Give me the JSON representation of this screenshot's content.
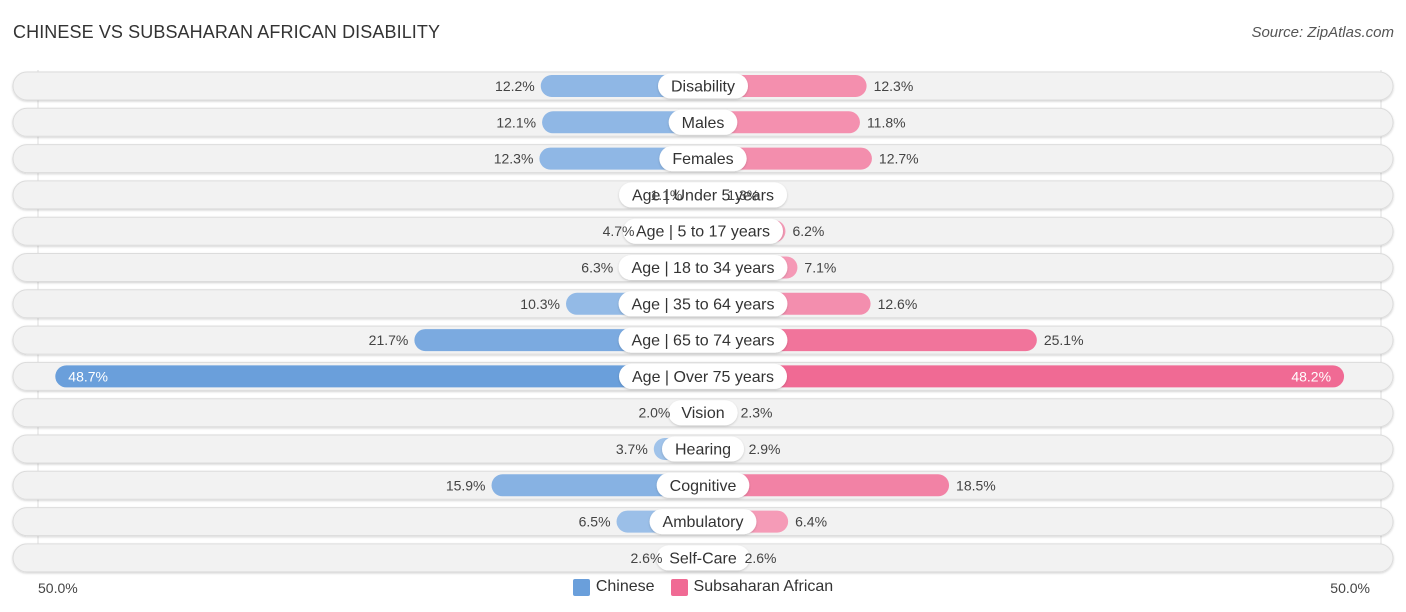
{
  "header": {
    "title": "CHINESE VS SUBSAHARAN AFRICAN DISABILITY",
    "source": "Source: ZipAtlas.com"
  },
  "colors": {
    "chinese": "#6a9fdb",
    "chinese_light": "#a8c8ec",
    "subsaharan": "#f06a94",
    "subsaharan_light": "#f6a8c0",
    "track": "#f2f2f2"
  },
  "chart_data": {
    "type": "bar",
    "orientation": "horizontal-diverging",
    "title": "CHINESE VS SUBSAHARAN AFRICAN DISABILITY",
    "categories": [
      "Disability",
      "Males",
      "Females",
      "Age | Under 5 years",
      "Age | 5 to 17 years",
      "Age | 18 to 34 years",
      "Age | 35 to 64 years",
      "Age | 65 to 74 years",
      "Age | Over 75 years",
      "Vision",
      "Hearing",
      "Cognitive",
      "Ambulatory",
      "Self-Care"
    ],
    "series": [
      {
        "name": "Chinese",
        "side": "left",
        "values": [
          12.2,
          12.1,
          12.3,
          1.1,
          4.7,
          6.3,
          10.3,
          21.7,
          48.7,
          2.0,
          3.7,
          15.9,
          6.5,
          2.6
        ]
      },
      {
        "name": "Subsaharan African",
        "side": "right",
        "values": [
          12.3,
          11.8,
          12.7,
          1.3,
          6.2,
          7.1,
          12.6,
          25.1,
          48.2,
          2.3,
          2.9,
          18.5,
          6.4,
          2.6
        ]
      }
    ],
    "value_suffix": "%",
    "xlim": [
      0,
      50
    ],
    "axis_labels": {
      "left": "50.0%",
      "right": "50.0%"
    },
    "legend": {
      "position": "bottom-center",
      "entries": [
        "Chinese",
        "Subsaharan African"
      ]
    }
  }
}
